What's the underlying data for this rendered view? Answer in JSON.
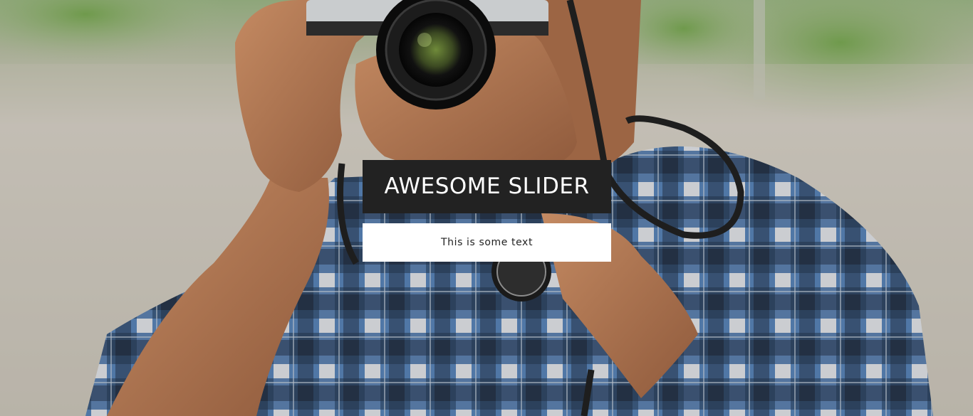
{
  "slide": {
    "title": "AWESOME SLIDER",
    "text": "This is some text"
  },
  "colors": {
    "title_bg": "#222222",
    "title_fg": "#ffffff",
    "text_bg": "#ffffff",
    "text_fg": "#222222"
  }
}
